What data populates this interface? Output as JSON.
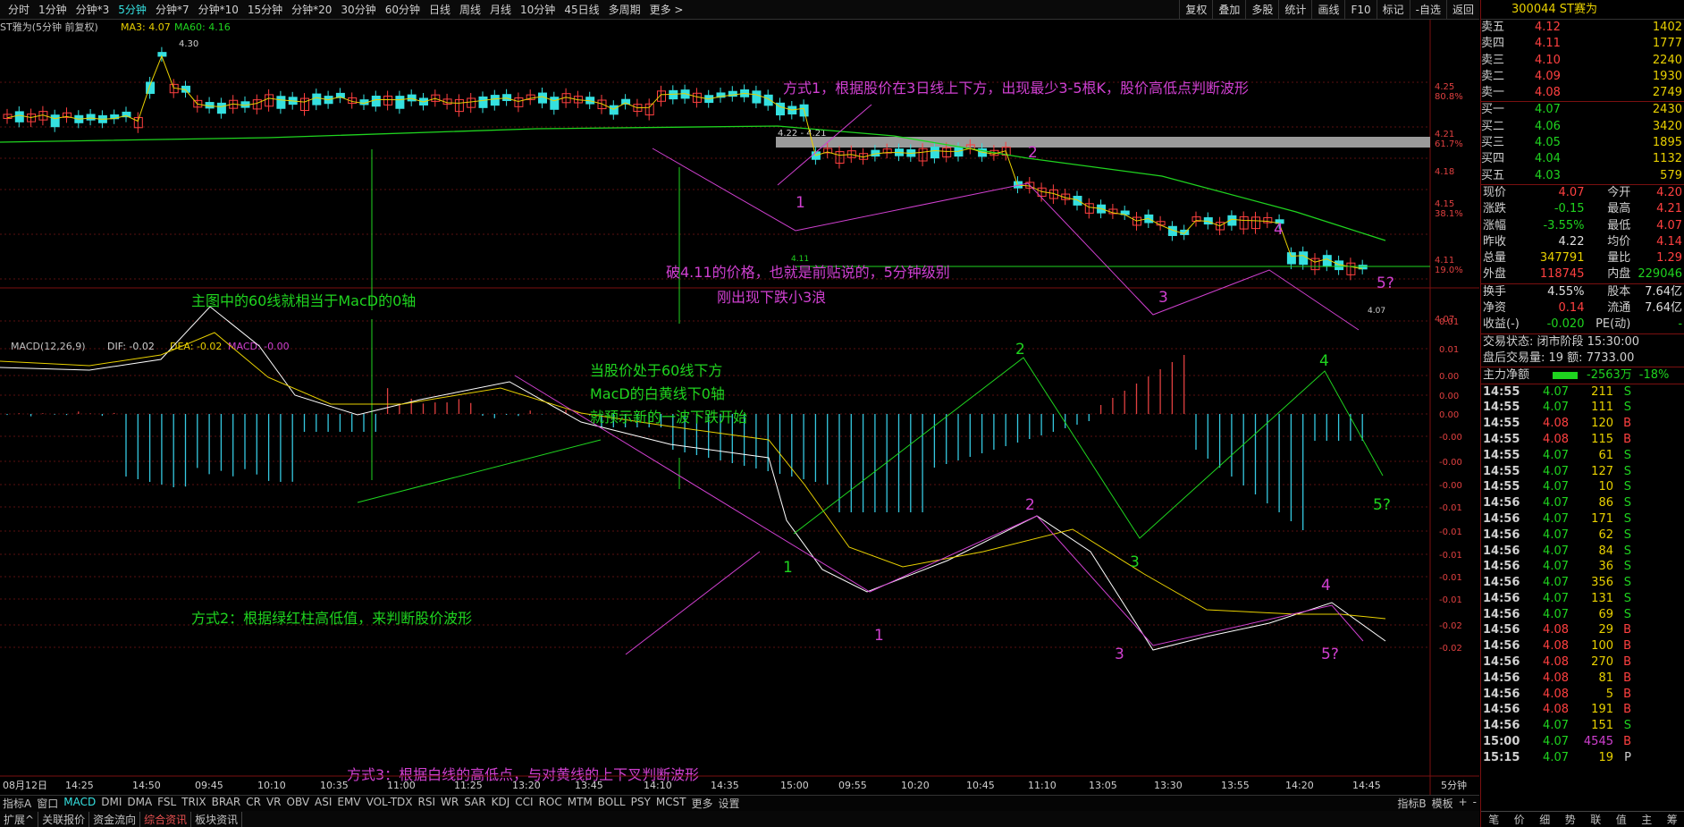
{
  "toolbar": {
    "items": [
      "分时",
      "1分钟",
      "分钟*3",
      "5分钟",
      "分钟*7",
      "分钟*10",
      "15分钟",
      "分钟*20",
      "30分钟",
      "60分钟",
      "日线",
      "周线",
      "月线",
      "10分钟",
      "45日线",
      "多周期",
      "更多 >"
    ],
    "active_index": 3,
    "right": [
      "复权",
      "叠加",
      "多股",
      "统计",
      "画线",
      "F10",
      "标记",
      "-自选",
      "返回"
    ]
  },
  "main_chart": {
    "title": "ST雅为(5分钟 前复权)",
    "ma3_label": "MA3: 4.07",
    "ma60_label": "MA60: 4.16",
    "high_label": "4.30",
    "range_label": "4.22 - 4.21",
    "level_label": "4.11",
    "low_label": "4.07",
    "y_ticks": [
      {
        "v": "4.25",
        "p": "80.8%"
      },
      {
        "v": "4.21",
        "p": "61.7%"
      },
      {
        "v": "4.18",
        "p": ""
      },
      {
        "v": "4.15",
        "p": "38.1%"
      },
      {
        "v": "4.11",
        "p": "19.0%"
      },
      {
        "v": "4.07",
        "p": ""
      }
    ]
  },
  "macd": {
    "title": "MACD(12,26,9)",
    "dif": "DIF: -0.02",
    "dea": "DEA: -0.02",
    "macd": "MACD: -0.00",
    "y_ticks": [
      "0.01",
      "0.01",
      "0.00",
      "0.00",
      "0.00",
      "-0.00",
      "-0.00",
      "-0.00",
      "-0.01",
      "-0.01",
      "-0.01",
      "-0.01",
      "-0.01",
      "-0.02",
      "-0.02"
    ]
  },
  "x_labels": [
    "08月12日",
    "14:25",
    "14:50",
    "09:45",
    "10:10",
    "10:35",
    "11:00",
    "11:25",
    "13:20",
    "13:45",
    "14:10",
    "14:35",
    "15:00",
    "09:55",
    "10:20",
    "10:45",
    "11:10",
    "13:05",
    "13:30",
    "13:55",
    "14:20",
    "14:45"
  ],
  "period_label": "5分钟",
  "annotations": {
    "method1": "方式1，根据股价在3日线上下方，出现最少3-5根K，股价高低点判断波形",
    "ma60_note": "主图中的60线就相当于MacD的0轴",
    "break_line1": "破4.11的价格，也就是前贴说的，5分钟级别",
    "break_line2": "刚出现下跌小3浪",
    "below60_1": "当股价处于60线下方",
    "below60_2": "MacD的白黄线下0轴",
    "below60_3": "就预示新的一波下跌开始",
    "method2": "方式2：根据绿红柱高低值，来判断股价波形",
    "method3": "方式3：根据白线的高低点，与对黄线的上下叉判断波形",
    "w1": "1",
    "w2": "2",
    "w3": "3",
    "w4": "4",
    "w5": "5?"
  },
  "bottom_tabs": [
    "指标A",
    "窗口",
    "MACD",
    "DMI",
    "DMA",
    "FSL",
    "TRIX",
    "BRAR",
    "CR",
    "VR",
    "OBV",
    "ASI",
    "EMV",
    "VOL-TDX",
    "RSI",
    "WR",
    "SAR",
    "KDJ",
    "CCI",
    "ROC",
    "MTM",
    "BOLL",
    "PSY",
    "MCST",
    "更多",
    "设置"
  ],
  "bottom_right": [
    "指标B",
    "模板",
    "+",
    "-"
  ],
  "status_bar": [
    "扩展^",
    "关联报价",
    "资金流向",
    "综合资讯",
    "板块资讯"
  ],
  "panel": {
    "code": "300044",
    "name": "ST赛为",
    "asks": [
      {
        "label": "卖五",
        "price": "4.12",
        "vol": "1402"
      },
      {
        "label": "卖四",
        "price": "4.11",
        "vol": "1777"
      },
      {
        "label": "卖三",
        "price": "4.10",
        "vol": "2240"
      },
      {
        "label": "卖二",
        "price": "4.09",
        "vol": "1930"
      },
      {
        "label": "卖一",
        "price": "4.08",
        "vol": "2749"
      }
    ],
    "bids": [
      {
        "label": "买一",
        "price": "4.07",
        "vol": "2430"
      },
      {
        "label": "买二",
        "price": "4.06",
        "vol": "3420"
      },
      {
        "label": "买三",
        "price": "4.05",
        "vol": "1895"
      },
      {
        "label": "买四",
        "price": "4.04",
        "vol": "1132"
      },
      {
        "label": "买五",
        "price": "4.03",
        "vol": "579"
      }
    ],
    "quote": [
      [
        "现价",
        "4.07",
        "今开",
        "4.20"
      ],
      [
        "涨跌",
        "-0.15",
        "最高",
        "4.21"
      ],
      [
        "涨幅",
        "-3.55%",
        "最低",
        "4.07"
      ],
      [
        "昨收",
        "4.22",
        "均价",
        "4.14"
      ],
      [
        "总量",
        "347791",
        "量比",
        "1.29"
      ],
      [
        "外盘",
        "118745",
        "内盘",
        "229046"
      ]
    ],
    "quote2": [
      [
        "换手",
        "4.55%",
        "股本",
        "7.64亿"
      ],
      [
        "净资",
        "0.14",
        "流通",
        "7.64亿"
      ],
      [
        "收益(-)",
        "-0.020",
        "PE(动)",
        "-"
      ]
    ],
    "trade_state": "交易状态: 闭市阶段 15:30:00",
    "after_hours": "盘后交易量: 19  额: 7733.00",
    "flow_label": "主力净额",
    "flow_val": "-2563万",
    "flow_pct": "-18%",
    "ticks": [
      [
        "14:55",
        "4.07",
        "211",
        "S"
      ],
      [
        "14:55",
        "4.07",
        "111",
        "S"
      ],
      [
        "14:55",
        "4.08",
        "120",
        "B"
      ],
      [
        "14:55",
        "4.08",
        "115",
        "B"
      ],
      [
        "14:55",
        "4.07",
        "61",
        "S"
      ],
      [
        "14:55",
        "4.07",
        "127",
        "S"
      ],
      [
        "14:55",
        "4.07",
        "10",
        "S"
      ],
      [
        "14:56",
        "4.07",
        "86",
        "S"
      ],
      [
        "14:56",
        "4.07",
        "171",
        "S"
      ],
      [
        "14:56",
        "4.07",
        "62",
        "S"
      ],
      [
        "14:56",
        "4.07",
        "84",
        "S"
      ],
      [
        "14:56",
        "4.07",
        "36",
        "S"
      ],
      [
        "14:56",
        "4.07",
        "356",
        "S"
      ],
      [
        "14:56",
        "4.07",
        "131",
        "S"
      ],
      [
        "14:56",
        "4.07",
        "69",
        "S"
      ],
      [
        "14:56",
        "4.08",
        "29",
        "B"
      ],
      [
        "14:56",
        "4.08",
        "100",
        "B"
      ],
      [
        "14:56",
        "4.08",
        "270",
        "B"
      ],
      [
        "14:56",
        "4.08",
        "81",
        "B"
      ],
      [
        "14:56",
        "4.08",
        "5",
        "B"
      ],
      [
        "14:56",
        "4.08",
        "191",
        "B"
      ],
      [
        "14:56",
        "4.07",
        "151",
        "S"
      ],
      [
        "15:00",
        "4.07",
        "4545",
        "B"
      ],
      [
        "15:15",
        "4.07",
        "19",
        "P"
      ]
    ],
    "panel_tabs": [
      "笔",
      "价",
      "细",
      "势",
      "联",
      "值",
      "主",
      "筹"
    ]
  }
}
